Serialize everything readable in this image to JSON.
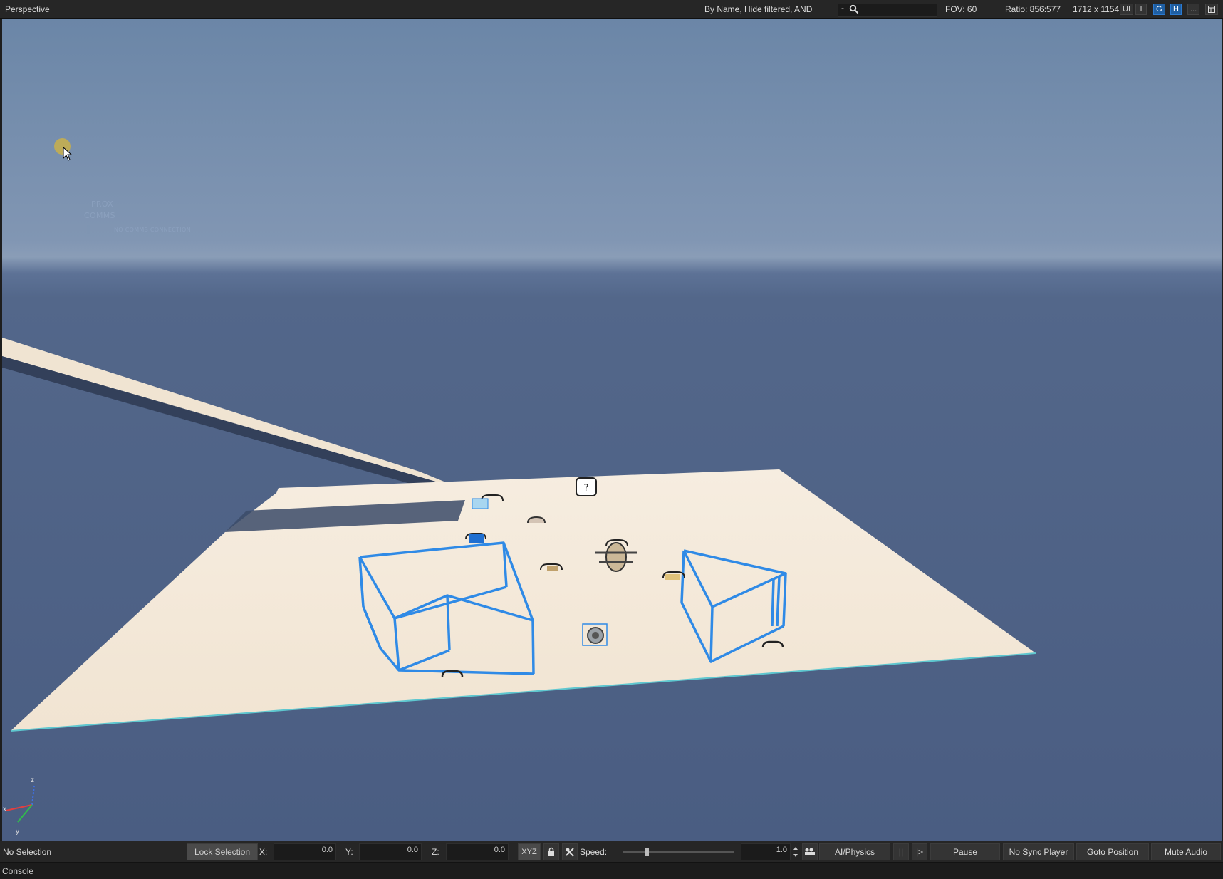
{
  "topbar": {
    "viewport_title": "Perspective",
    "filter_text": "By Name, Hide filtered, AND",
    "search_dash": "-",
    "search_placeholder": "",
    "fov": "FOV: 60",
    "ratio": "Ratio: 856:577",
    "size": "1712 x 1154",
    "buttons": {
      "ui": "UI",
      "i": "I",
      "g": "G",
      "h": "H",
      "more": "..."
    }
  },
  "hud": {
    "prox": "PROX",
    "comms": "COMMS",
    "no_comms": "NO COMMS CONNECTION"
  },
  "gizmo": {
    "z": "z",
    "x": "x",
    "y": "y"
  },
  "scene": {
    "marker_question": "?",
    "colors": {
      "sky_top": "#6c87a8",
      "horizon": "#8ea3bd",
      "ground": "#4e6286",
      "platform": "#f3e8d6",
      "wireframe": "#2f8ae6"
    }
  },
  "bottombar": {
    "selection_status": "No Selection",
    "lock_selection": "Lock Selection",
    "x_label": "X:",
    "x_value": "0.0",
    "y_label": "Y:",
    "y_value": "0.0",
    "z_label": "Z:",
    "z_value": "0.0",
    "xyz": "XYZ",
    "speed_label": "Speed:",
    "speed_value": "1.0",
    "ai_physics": "AI/Physics",
    "pause_bars": "||",
    "step": "|>",
    "pause": "Pause",
    "no_sync": "No Sync Player",
    "goto": "Goto Position",
    "mute": "Mute Audio"
  },
  "console": {
    "label": "Console"
  }
}
